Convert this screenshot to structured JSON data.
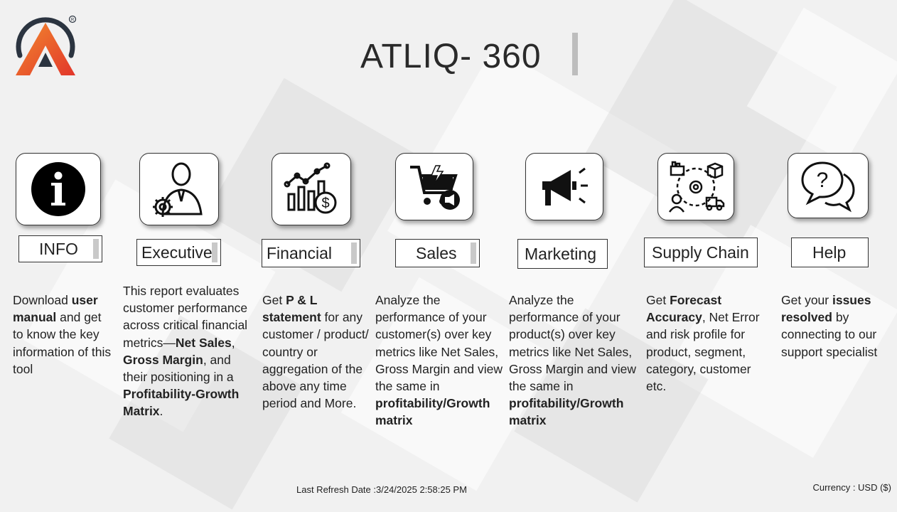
{
  "app": {
    "title": "ATLIQ- 360"
  },
  "footer": {
    "refresh_label": "Last Refresh Date :",
    "refresh_value": "3/24/2025 2:58:25 PM",
    "currency": "Currency : USD ($)"
  },
  "cards": [
    {
      "id": "info",
      "label": "INFO",
      "icon": "info-icon",
      "desc_parts": [
        [
          "Download ",
          false
        ],
        [
          "user manual",
          true
        ],
        [
          " and get to know the key information of this tool",
          false
        ]
      ]
    },
    {
      "id": "executive",
      "label": "Executive",
      "icon": "executive-icon",
      "desc_parts": [
        [
          "This report evaluates customer performance across critical financial metrics—",
          false
        ],
        [
          "Net Sales",
          true
        ],
        [
          ", ",
          false
        ],
        [
          "Gross Margin",
          true
        ],
        [
          ", and their positioning in a ",
          false
        ],
        [
          "Profitability-Growth Matrix",
          true
        ],
        [
          ".",
          false
        ]
      ]
    },
    {
      "id": "financial",
      "label": "Financial",
      "icon": "financial-chart-icon",
      "desc_parts": [
        [
          "Get ",
          false
        ],
        [
          "P & L statement",
          true
        ],
        [
          " for any customer / product/ country or aggregation of the above any time period and More.",
          false
        ]
      ]
    },
    {
      "id": "sales",
      "label": "Sales",
      "icon": "sales-cart-icon",
      "desc_parts": [
        [
          "Analyze the performance of your customer(s) over key metrics like Net Sales, Gross Margin and view the same in ",
          false
        ],
        [
          "profitability/Growth matrix",
          true
        ]
      ]
    },
    {
      "id": "marketing",
      "label": "Marketing",
      "icon": "megaphone-icon",
      "desc_parts": [
        [
          "Analyze the performance of your product(s) over key metrics like Net Sales, Gross Margin and view the same in ",
          false
        ],
        [
          "profitability/Growth matrix",
          true
        ]
      ]
    },
    {
      "id": "supply-chain",
      "label": "Supply Chain",
      "icon": "supply-chain-icon",
      "desc_parts": [
        [
          "Get ",
          false
        ],
        [
          "Forecast Accuracy",
          true
        ],
        [
          ", Net Error and risk profile for product, segment, category, customer etc.",
          false
        ]
      ]
    },
    {
      "id": "help",
      "label": "Help",
      "icon": "help-chat-icon",
      "desc_parts": [
        [
          "Get your ",
          false
        ],
        [
          "issues resolved",
          true
        ],
        [
          " by connecting to our support specialist",
          false
        ]
      ]
    }
  ],
  "colors": {
    "logo_ring": "#2b3440",
    "logo_a_start": "#f28a2e",
    "logo_a_end": "#e2362b",
    "accent_bar": "#c9c9c9"
  }
}
